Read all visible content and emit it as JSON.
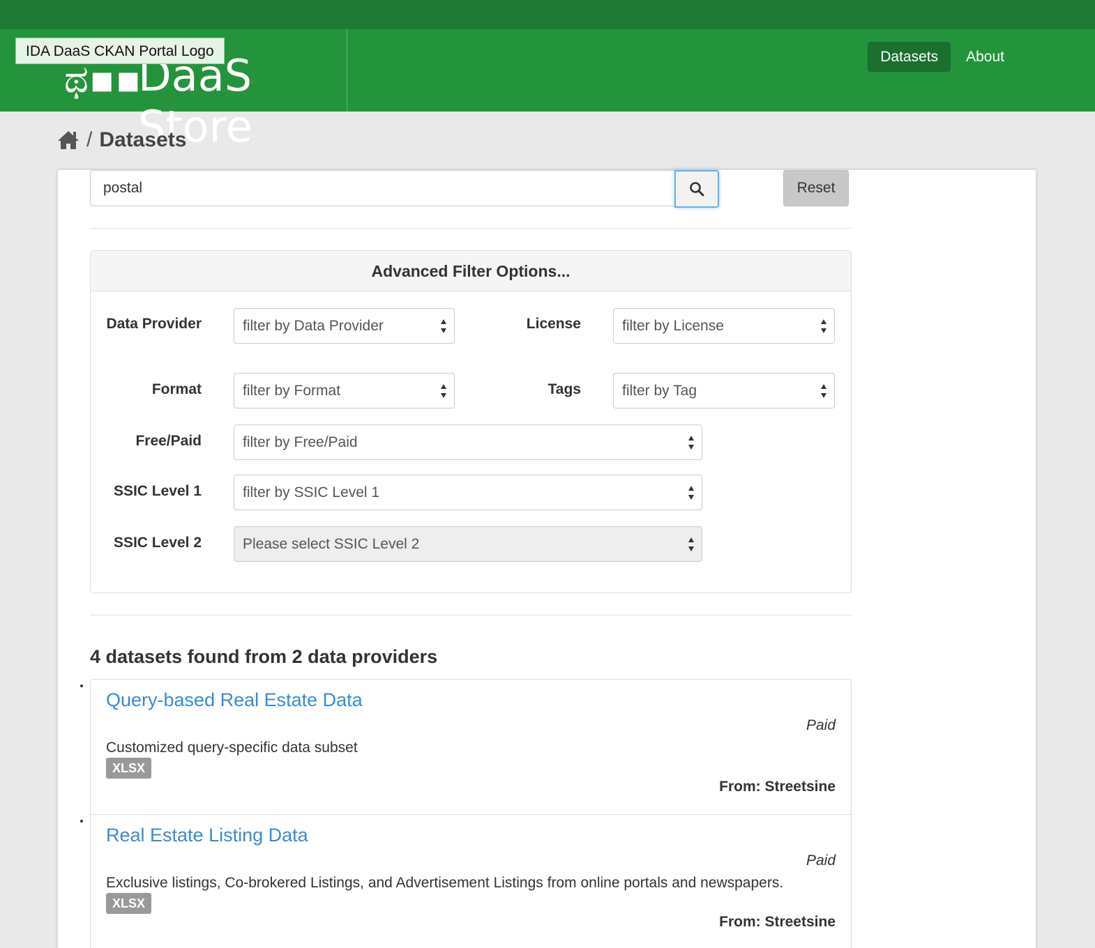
{
  "header": {
    "logo_alt": "IDA DaaS CKAN Portal Logo",
    "logo_glyph": "ಥ▪▪",
    "logo_word": "DaaS Store",
    "nav": [
      {
        "label": "Datasets",
        "active": true
      },
      {
        "label": "About",
        "active": false
      }
    ],
    "colors": {
      "topstrip": "#1e7a34",
      "masthead": "#23943c",
      "nav_active": "#1b6f2f"
    }
  },
  "breadcrumb": {
    "home_icon": "home-icon",
    "separator": "/",
    "current": "Datasets"
  },
  "search": {
    "value": "postal",
    "button_icon": "search-icon",
    "reset_label": "Reset"
  },
  "filters": {
    "title": "Advanced Filter Options...",
    "data_provider": {
      "label": "Data Provider",
      "value": "filter by Data Provider"
    },
    "license": {
      "label": "License",
      "value": "filter by License"
    },
    "format": {
      "label": "Format",
      "value": "filter by Format"
    },
    "tags": {
      "label": "Tags",
      "value": "filter by Tag"
    },
    "free_paid": {
      "label": "Free/Paid",
      "value": "filter by Free/Paid"
    },
    "ssic1": {
      "label": "SSIC Level 1",
      "value": "filter by SSIC Level 1"
    },
    "ssic2": {
      "label": "SSIC Level 2",
      "value": "Please select SSIC Level 2",
      "disabled": true
    }
  },
  "results": {
    "count": "4",
    "text_mid": " datasets found from ",
    "providers": "2",
    "text_end": " data providers",
    "items": [
      {
        "title": "Query-based Real Estate Data",
        "price": "Paid",
        "description": "Customized query-specific data subset",
        "format": "XLSX",
        "from": "From: Streetsine"
      },
      {
        "title": "Real Estate Listing Data",
        "price": "Paid",
        "description": "Exclusive listings, Co-brokered Listings, and Advertisement Listings from online portals and newspapers.",
        "format": "XLSX",
        "from": "From: Streetsine"
      }
    ],
    "link_color": "#3a8ad3"
  }
}
